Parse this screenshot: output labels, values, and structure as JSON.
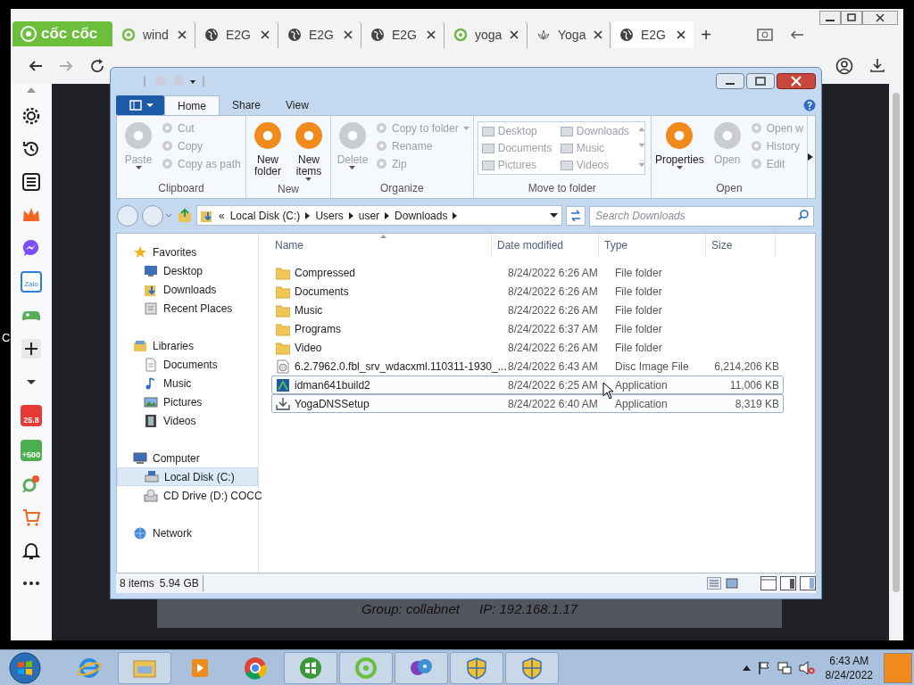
{
  "stray_text": "C",
  "browser": {
    "logo": "cốc cốc",
    "tabs": [
      {
        "label": "wind",
        "kind": "leaf",
        "selected": false
      },
      {
        "label": "E2G",
        "kind": "globe",
        "selected": false
      },
      {
        "label": "E2G",
        "kind": "globe",
        "selected": false
      },
      {
        "label": "E2G",
        "kind": "globe",
        "selected": false
      },
      {
        "label": "yoga",
        "kind": "leaf",
        "selected": false
      },
      {
        "label": "Yoga",
        "kind": "lotus",
        "selected": false
      },
      {
        "label": "E2G",
        "kind": "globe",
        "selected": true
      }
    ],
    "new_tab": "+",
    "sidebar": [
      {
        "kind": "settings"
      },
      {
        "kind": "history"
      },
      {
        "kind": "list"
      },
      {
        "kind": "crown"
      },
      {
        "kind": "chat"
      },
      {
        "kind": "zalo",
        "label": "Zalo"
      },
      {
        "kind": "game"
      },
      {
        "kind": "plus"
      },
      {
        "kind": "caret"
      },
      {
        "kind": "bag",
        "label": "25.8"
      },
      {
        "kind": "gift",
        "label": "+500"
      },
      {
        "kind": "pin"
      },
      {
        "kind": "cart"
      },
      {
        "kind": "bell"
      },
      {
        "kind": "more"
      }
    ]
  },
  "explorer": {
    "ribbon_tabs": [
      {
        "label": "Home",
        "selected": true
      },
      {
        "label": "Share",
        "selected": false
      },
      {
        "label": "View",
        "selected": false
      }
    ],
    "groups": [
      {
        "title": "Clipboard",
        "items": [
          {
            "kind": "large",
            "label": "Paste",
            "disabled": true,
            "dropdown": true
          },
          {
            "kind": "small",
            "label": "Cut",
            "disabled": true
          },
          {
            "kind": "small",
            "label": "Copy",
            "disabled": true
          },
          {
            "kind": "small",
            "label": "Copy as path",
            "disabled": true
          }
        ]
      },
      {
        "title": "New",
        "items": [
          {
            "kind": "large",
            "label": "New folder",
            "disabled": false,
            "dropdown": false
          },
          {
            "kind": "large",
            "label": "New items",
            "disabled": false,
            "dropdown": true
          }
        ]
      },
      {
        "title": "Organize",
        "items": [
          {
            "kind": "large",
            "label": "Delete",
            "disabled": true,
            "dropdown": true
          },
          {
            "kind": "small",
            "label": "Copy to folder",
            "disabled": true,
            "dropdown": true
          },
          {
            "kind": "small",
            "label": "Rename",
            "disabled": true
          },
          {
            "kind": "small",
            "label": "Zip",
            "disabled": true
          }
        ]
      },
      {
        "title": "Move to folder",
        "items": [
          {
            "kind": "gallery",
            "entries": [
              "Desktop",
              "Downloads",
              "Documents",
              "Music",
              "Pictures",
              "Videos"
            ],
            "disabled": true
          }
        ]
      },
      {
        "title": "Open",
        "items": [
          {
            "kind": "large",
            "label": "Properties",
            "disabled": false,
            "dropdown": true
          },
          {
            "kind": "large",
            "label": "Open",
            "disabled": true,
            "dropdown": false
          },
          {
            "kind": "small",
            "label": "Open w",
            "disabled": true
          },
          {
            "kind": "small",
            "label": "History",
            "disabled": true
          },
          {
            "kind": "small",
            "label": "Edit",
            "disabled": true
          }
        ]
      }
    ],
    "breadcrumb_prefix": "«",
    "breadcrumb": [
      "Local Disk (C:)",
      "Users",
      "user",
      "Downloads"
    ],
    "search": {
      "placeholder": "Search Downloads"
    },
    "nav": [
      {
        "label": "Favorites",
        "kind": "star",
        "selected": false,
        "children": [
          {
            "label": "Desktop",
            "kind": "desktop",
            "selected": false
          },
          {
            "label": "Downloads",
            "kind": "downloads",
            "selected": false
          },
          {
            "label": "Recent Places",
            "kind": "recent",
            "selected": false
          }
        ]
      },
      {
        "label": "Libraries",
        "kind": "library",
        "selected": false,
        "children": [
          {
            "label": "Documents",
            "kind": "document",
            "selected": false
          },
          {
            "label": "Music",
            "kind": "music",
            "selected": false
          },
          {
            "label": "Pictures",
            "kind": "picture",
            "selected": false
          },
          {
            "label": "Videos",
            "kind": "video",
            "selected": false
          }
        ]
      },
      {
        "label": "Computer",
        "kind": "computer",
        "selected": false,
        "children": [
          {
            "label": "Local Disk (C:)",
            "kind": "disk",
            "selected": true
          },
          {
            "label": "CD Drive (D:) COCC",
            "kind": "cd",
            "selected": false
          }
        ]
      },
      {
        "label": "Network",
        "kind": "network",
        "selected": false
      }
    ],
    "columns": [
      "Name",
      "Date modified",
      "Type",
      "Size"
    ],
    "rows": [
      {
        "kind": "folder",
        "name": "Compressed",
        "date": "8/24/2022 6:26 AM",
        "type": "File folder",
        "selected": false
      },
      {
        "kind": "folder",
        "name": "Documents",
        "date": "8/24/2022 6:26 AM",
        "type": "File folder",
        "selected": false
      },
      {
        "kind": "folder",
        "name": "Music",
        "date": "8/24/2022 6:26 AM",
        "type": "File folder",
        "selected": false
      },
      {
        "kind": "folder",
        "name": "Programs",
        "date": "8/24/2022 6:37 AM",
        "type": "File folder",
        "selected": false
      },
      {
        "kind": "folder",
        "name": "Video",
        "date": "8/24/2022 6:26 AM",
        "type": "File folder",
        "selected": false
      },
      {
        "kind": "disc",
        "name": "6.2.7962.0.fbl_srv_wdacxml.110311-1930_...",
        "date": "8/24/2022 6:43 AM",
        "type": "Disc Image File",
        "size": "6,214,206 KB",
        "selected": false
      },
      {
        "kind": "app",
        "name": "idman641build2",
        "date": "8/24/2022 6:25 AM",
        "type": "Application",
        "size": "11,006 KB",
        "selected": true
      },
      {
        "kind": "setup",
        "name": "YogaDNSSetup",
        "date": "8/24/2022 6:40 AM",
        "type": "Application",
        "size": "8,319 KB",
        "selected": true
      }
    ],
    "status": [
      "8 items",
      "5.94 GB"
    ]
  },
  "remote_bar": [
    "Group: collabnet",
    "IP: 192.168.1.17"
  ],
  "taskbar": {
    "apps": [
      {
        "kind": "ie",
        "running": false
      },
      {
        "kind": "explorer",
        "running": true
      },
      {
        "kind": "media",
        "running": false
      },
      {
        "kind": "chrome",
        "running": false
      },
      {
        "kind": "windows",
        "running": true
      },
      {
        "kind": "leaf",
        "running": true
      },
      {
        "kind": "disc",
        "running": true
      },
      {
        "kind": "shield",
        "running": true
      },
      {
        "kind": "shield",
        "running": true
      }
    ],
    "time": "6:43 AM",
    "date": "8/24/2022"
  }
}
